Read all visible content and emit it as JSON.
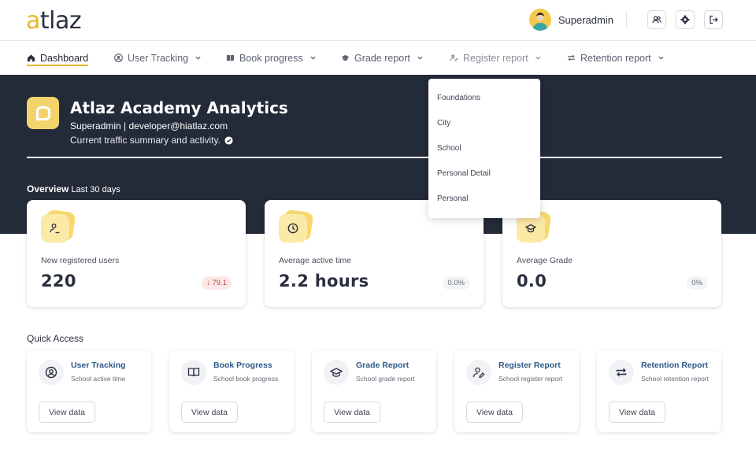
{
  "header": {
    "logo_prefix": "a",
    "logo_rest": "tlaz",
    "username": "Superadmin"
  },
  "nav": {
    "items": [
      {
        "label": "Dashboard",
        "icon": "home-icon"
      },
      {
        "label": "User Tracking",
        "icon": "user-circle-icon"
      },
      {
        "label": "Book progress",
        "icon": "book-icon"
      },
      {
        "label": "Grade report",
        "icon": "graduation-cap-icon"
      },
      {
        "label": "Register report",
        "icon": "user-edit-icon"
      },
      {
        "label": "Retention report",
        "icon": "repeat-icon"
      }
    ]
  },
  "hero": {
    "title": "Atlaz Academy Analytics",
    "subtitle": "Superadmin | developer@hiatlaz.com",
    "description": "Current traffic summary and activity."
  },
  "overview": {
    "title": "Overview",
    "period": "Last 30 days"
  },
  "stats": [
    {
      "label": "New registered users",
      "value": "220",
      "badge": "↓ 79.1",
      "icon": "user-edit-icon"
    },
    {
      "label": "Average active time",
      "value": "2.2 hours",
      "badge": "0.0%",
      "icon": "clock-icon"
    },
    {
      "label": "Average Grade",
      "value": "0.0",
      "badge": "0%",
      "icon": "graduation-cap-icon"
    }
  ],
  "dropdown": {
    "items": [
      "Foundations",
      "City",
      "School",
      "Personal Detail",
      "Personal"
    ]
  },
  "quick_access": {
    "title": "Quick Access",
    "button_label": "View data",
    "cards": [
      {
        "name": "User Tracking",
        "desc": "School active time",
        "icon": "user-circle-icon"
      },
      {
        "name": "Book Progress",
        "desc": "School book progress",
        "icon": "book-icon"
      },
      {
        "name": "Grade Report",
        "desc": "School grade report",
        "icon": "graduation-cap-icon"
      },
      {
        "name": "Register Report",
        "desc": "School register report",
        "icon": "user-edit-icon"
      },
      {
        "name": "Retention Report",
        "desc": "School retention report",
        "icon": "repeat-icon"
      }
    ]
  },
  "colors": {
    "accent": "#e6b82e",
    "hero_bg": "#232a38",
    "link": "#2f5a8a"
  }
}
